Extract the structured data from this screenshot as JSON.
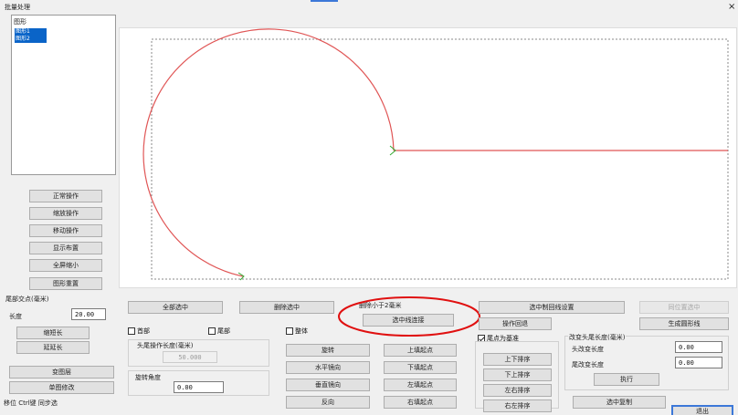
{
  "window": {
    "title": "批量处理",
    "close_glyph": "×"
  },
  "layer_list": {
    "header": "图形",
    "items": [
      {
        "label": "图形1",
        "selected": true
      },
      {
        "label": "图形2",
        "selected": true
      }
    ]
  },
  "left_panel": {
    "buttons": [
      "正常操作",
      "缩放操作",
      "移动操作",
      "显示布置",
      "全屏缩小",
      "图形重置"
    ],
    "tail_section_label": "尾部交点(毫米)",
    "length_label": "长度",
    "length_value": "20.00",
    "btn_shorten": "缩短长",
    "btn_extend": "延延长",
    "btn_change_layer": "变图层",
    "btn_single_modify": "单图修改",
    "hint": "移位 Ctrl键 同步选"
  },
  "bottom_bar": {
    "select_all": "全部选中",
    "delete_selected": "删除选中",
    "filter_label": "删除小于2毫米",
    "selected_line_connect": "选中线连接",
    "chk_head": "首部",
    "chk_tail": "尾部",
    "chk_whole": "整体",
    "head_tail_len_label": "头尾操作长度(毫米)",
    "head_tail_len_value": "50.000",
    "rotate_angle_label": "旋转角度",
    "rotate_angle_value": "0.00",
    "rotate": "旋转",
    "mirror_h": "水平镜向",
    "mirror_v": "垂直镜向",
    "reverse": "反向",
    "move_up": "上填起点",
    "move_down": "下填起点",
    "move_left": "左填起点",
    "move_right": "右填起点",
    "selected_spring_settings": "选中制回线设置",
    "sort_settings": "操作回退",
    "chk_tail_as_head": "尾点为基准",
    "sort_ud": "上下排序",
    "sort_du": "下上排序",
    "sort_lr": "左右排序",
    "sort_rl": "右左排序",
    "selected_copy": "选中复制",
    "same_pos_select": "同位置选中",
    "gen_circle": "生成圆形线",
    "change_head_tail_label": "改变头尾长度(毫米)",
    "head_change_label": "头改变长度",
    "head_change_value": "0.00",
    "tail_change_label": "尾改变长度",
    "tail_change_value": "0.00",
    "execute": "执行",
    "exit": "退出"
  },
  "colors": {
    "curve": "#e05555",
    "marker": "#33aa33",
    "highlight_ellipse": "#e01010",
    "selection": "#0a64c8"
  }
}
